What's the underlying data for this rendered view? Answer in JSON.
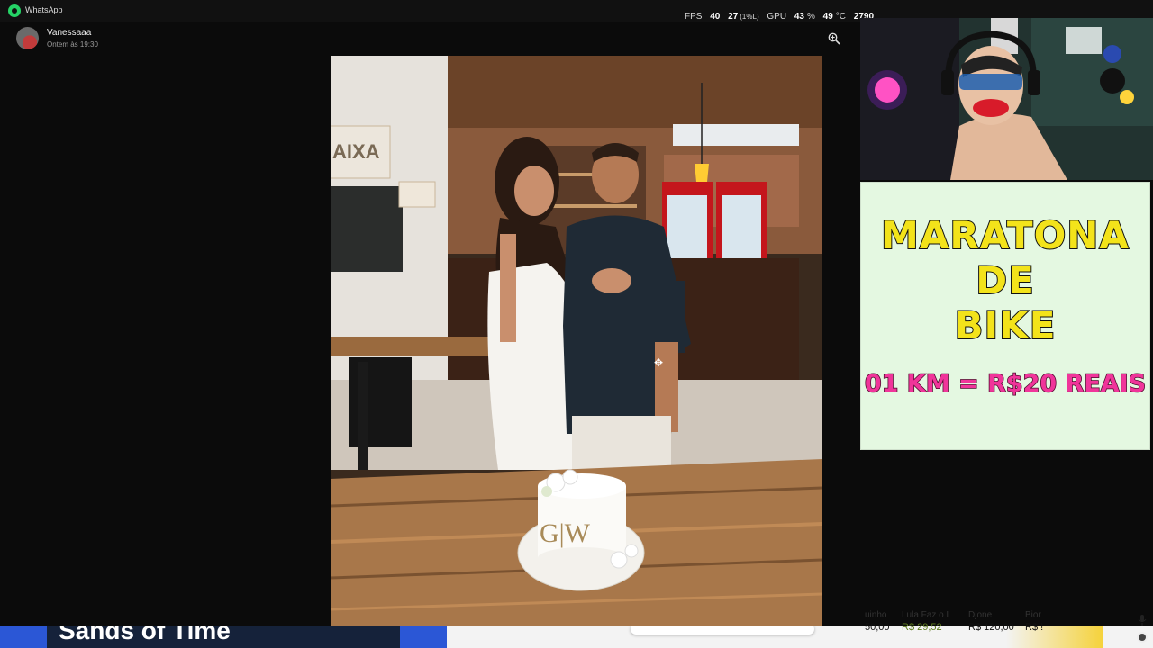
{
  "app": {
    "title": "WhatsApp"
  },
  "overlay": {
    "fps_label": "FPS",
    "fps_value": "40",
    "fps_low": "27",
    "fps_low_pct": "(1%L)",
    "gpu_label": "GPU",
    "gpu_load": "43",
    "gpu_load_unit": "%",
    "gpu_temp": "49",
    "gpu_temp_unit": "°C",
    "gpu_clock": "2790"
  },
  "chat": {
    "contact_name": "Vanessaaa",
    "timestamp": "Ontem às 19:30"
  },
  "photo": {
    "cake_monogram": "G|W",
    "cafe_sign": "AIXA"
  },
  "banner": {
    "line1": "MARATONA",
    "line2": "DE",
    "line3": "BIKE",
    "price": "01 KM = R$20 REAIS",
    "accent_yellow": "#f3e31a",
    "accent_pink": "#f0359a"
  },
  "bottom": {
    "movie_title": "Sands of Time",
    "donations": [
      {
        "name": "uinho",
        "amount": "50,00"
      },
      {
        "name": "Lula Faz o L",
        "amount": "R$ 29,52"
      },
      {
        "name": "Djone",
        "amount": "R$ 120,00"
      },
      {
        "name": "Bior",
        "amount": "R$ !"
      }
    ]
  }
}
